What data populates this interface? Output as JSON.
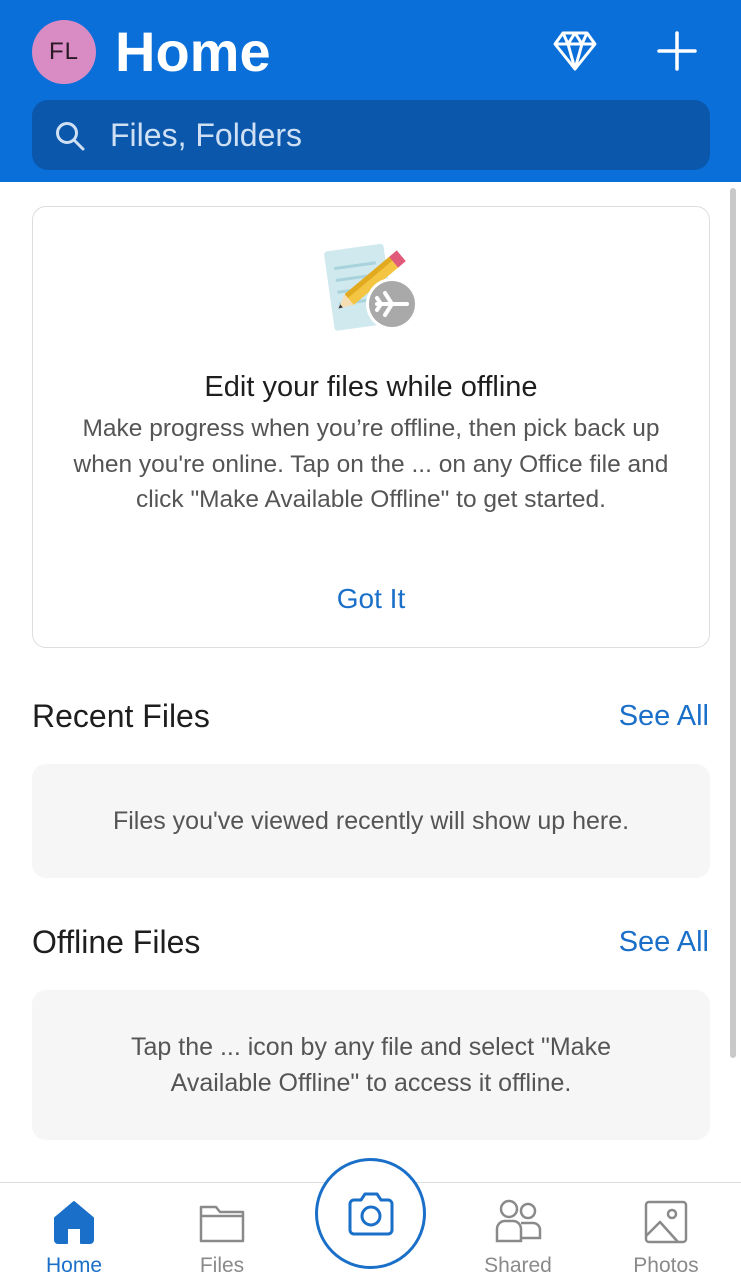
{
  "header": {
    "avatar_initials": "FL",
    "title": "Home",
    "premium_icon": "diamond-icon",
    "add_icon": "plus-icon",
    "background": "#0a6fd8"
  },
  "search": {
    "placeholder": "Files, Folders",
    "icon": "search-icon"
  },
  "promo": {
    "title": "Edit your files while offline",
    "body": "Make progress when you’re offline, then pick back up when you're online. Tap on the ... on any Office file and click \"Make Available Offline\" to get started.",
    "button": "Got It"
  },
  "recent": {
    "title": "Recent Files",
    "see_all": "See All",
    "empty": "Files you've viewed recently will show up here."
  },
  "offline": {
    "title": "Offline Files",
    "see_all": "See All",
    "empty": "Tap the ... icon by any file and select \"Make Available Offline\" to access it offline."
  },
  "tabs": [
    {
      "label": "Home",
      "icon": "home-icon",
      "active": true
    },
    {
      "label": "Files",
      "icon": "folder-icon",
      "active": false
    },
    {
      "label": "Shared",
      "icon": "people-icon",
      "active": false
    },
    {
      "label": "Photos",
      "icon": "photo-icon",
      "active": false
    }
  ],
  "camera": {
    "icon": "camera-icon"
  },
  "colors": {
    "accent": "#1a6fc9",
    "header": "#0a6fd8",
    "search_bg": "#0a57ab",
    "avatar": "#d98bc4"
  }
}
